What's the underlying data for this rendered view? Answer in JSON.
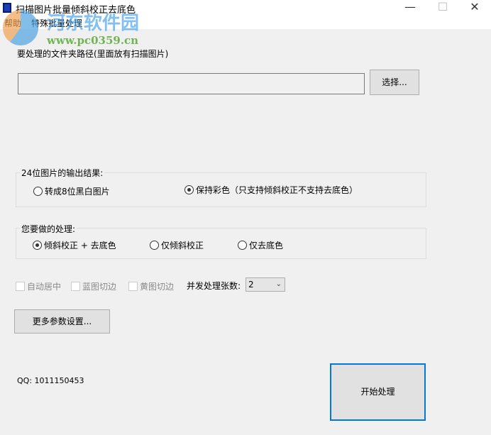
{
  "window": {
    "title": "扫描图片批量倾斜校正去底色",
    "minimize": "—",
    "maximize": "☐",
    "close": "✕"
  },
  "menu": [
    "帮助",
    "特殊批量处理"
  ],
  "watermark": {
    "name": "河东软件园",
    "url": "www.pc0359.cn"
  },
  "path": {
    "label": "要处理的文件夹路径(里面放有扫描图片)",
    "value": "",
    "browse": "选择..."
  },
  "output": {
    "title": "24位图片的输出结果:",
    "options": [
      "转成8位黑白图片",
      "保持彩色（只支持倾斜校正不支持去底色）"
    ],
    "selected": 1
  },
  "process": {
    "title": "您要做的处理:",
    "options": [
      "倾斜校正 + 去底色",
      "仅倾斜校正",
      "仅去底色"
    ],
    "selected": 0
  },
  "checks": [
    "自动居中",
    "蓝图切边",
    "黄图切边"
  ],
  "concurrency": {
    "label": "并发处理张数:",
    "value": "2"
  },
  "more": "更多参数设置...",
  "qq": "QQ: 1011150453",
  "start": "开始处理"
}
